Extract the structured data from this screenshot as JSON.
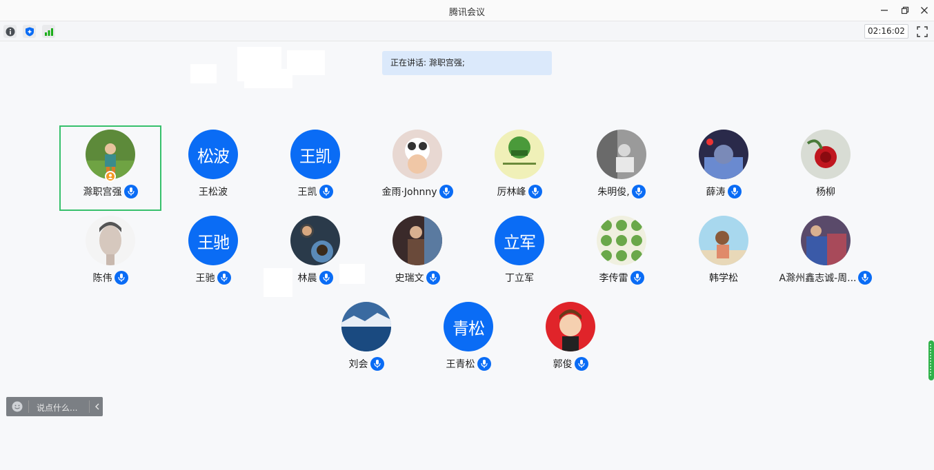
{
  "window": {
    "title": "腾讯会议"
  },
  "toolbar": {
    "timer": "02:16:02",
    "icons": [
      "info-icon",
      "shield-icon",
      "signal-icon",
      "fullscreen-icon"
    ]
  },
  "speaking": {
    "text": "正在讲话: 滁职宫强;"
  },
  "participants": [
    {
      "name": "滁职宫强",
      "avatar": "photo",
      "mic": true,
      "host": true,
      "selected": true
    },
    {
      "name": "王松波",
      "avatar_text": "松波",
      "mic": false
    },
    {
      "name": "王凯",
      "avatar_text": "王凯",
      "mic": true
    },
    {
      "name": "金雨·Johnny",
      "avatar": "photo",
      "mic": true
    },
    {
      "name": "厉林峰",
      "avatar": "photo",
      "mic": true
    },
    {
      "name": "朱明俊,",
      "avatar": "photo",
      "mic": true
    },
    {
      "name": "薛涛",
      "avatar": "photo",
      "mic": true
    },
    {
      "name": "杨柳",
      "avatar": "photo",
      "mic": false
    },
    {
      "name": "陈伟",
      "avatar": "photo",
      "mic": true
    },
    {
      "name": "王驰",
      "avatar_text": "王驰",
      "mic": true
    },
    {
      "name": "林晨",
      "avatar": "photo",
      "mic": true
    },
    {
      "name": "史瑞文",
      "avatar": "photo",
      "mic": true
    },
    {
      "name": "丁立军",
      "avatar_text": "立军",
      "mic": false
    },
    {
      "name": "李传雷",
      "avatar": "photo",
      "mic": true
    },
    {
      "name": "韩学松",
      "avatar": "photo",
      "mic": false
    },
    {
      "name": "A滁州鑫志诚-周...",
      "avatar": "photo",
      "mic": true
    },
    {
      "name": "刘会",
      "avatar": "photo",
      "mic": true
    },
    {
      "name": "王青松",
      "avatar_text": "青松",
      "mic": true
    },
    {
      "name": "郭俊",
      "avatar": "photo",
      "mic": true
    }
  ],
  "chat": {
    "placeholder": "说点什么..."
  },
  "colors": {
    "accent": "#0a6cf5",
    "selected_border": "#36c06b",
    "speaking_bg": "#dbe9fb"
  }
}
